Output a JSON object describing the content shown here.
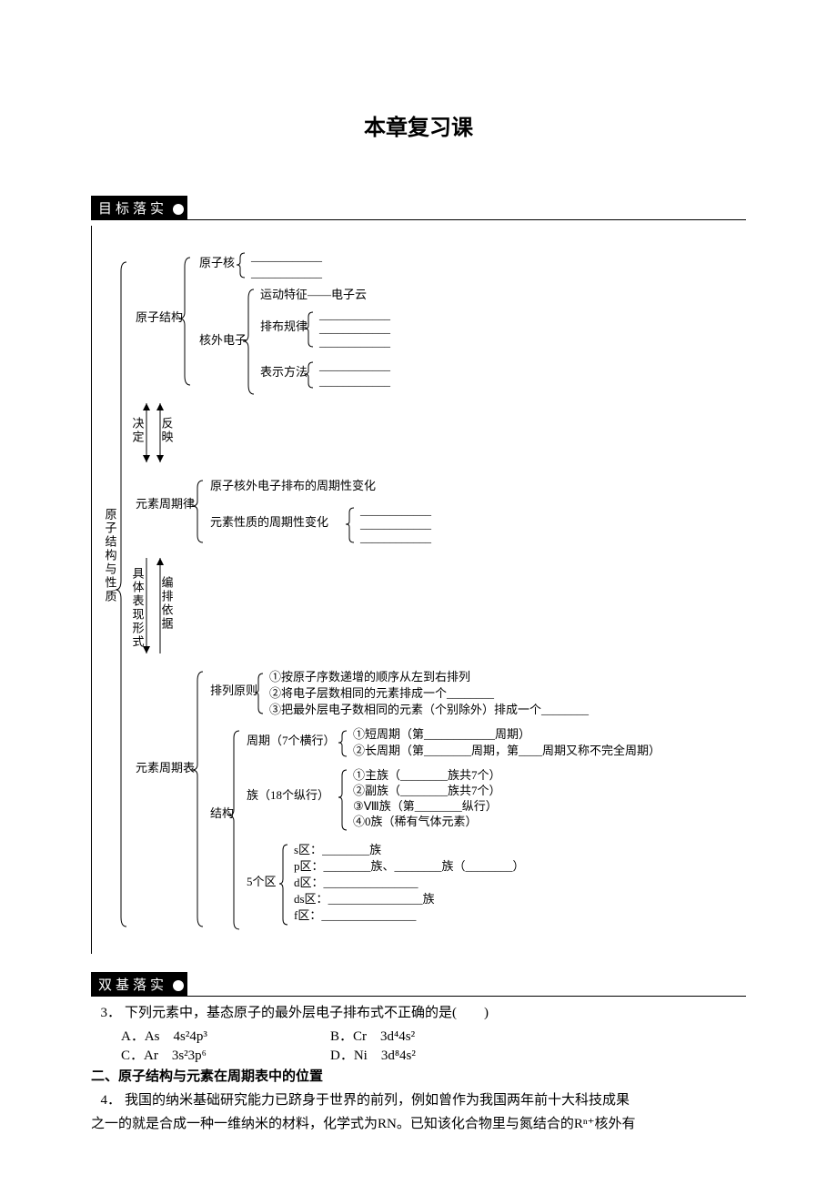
{
  "title": "本章复习课",
  "section1_label": "目标落实",
  "section2_label": "双基落实",
  "outline": {
    "root": "原子结构与性质",
    "arrow_down": "决定",
    "arrow_up": "反映",
    "arrow2_label": "具体表现形式",
    "arrow2_right": "编排依据",
    "n1": {
      "label": "原子结构",
      "a": {
        "label": "原子核",
        "blank1": "____________",
        "blank2": "____________"
      },
      "b": {
        "label": "核外电子",
        "i": "运动特征——电子云",
        "ii": {
          "label": "排布规律",
          "blank1": "____________",
          "blank2": "____________",
          "blank3": "____________"
        },
        "iii": {
          "label": "表示方法",
          "blank1": "____________",
          "blank2": "____________"
        }
      }
    },
    "n2": {
      "label": "元素周期律",
      "a": "原子核外电子排布的周期性变化",
      "b": {
        "label": "元素性质的周期性变化",
        "blank1": "____________",
        "blank2": "____________",
        "blank3": "____________"
      }
    },
    "n3": {
      "label": "元素周期表",
      "a": {
        "label": "排列原则",
        "i": "①按原子序数递增的顺序从左到右排列",
        "ii_pre": "②将电子层数相同的元素排成一个",
        "ii_blank": "________",
        "iii_pre": "③把最外层电子数相同的元素（个别除外）排成一个",
        "iii_blank": "________"
      },
      "b": {
        "label": "结构",
        "period": {
          "label": "周期（7个横行）",
          "i_pre": "①短周期（第",
          "i_blank": "____________",
          "i_post": "周期）",
          "ii_pre": "②长周期（第",
          "ii_blank": "________",
          "ii_mid": "周期，第",
          "ii_blank2": "____",
          "ii_post": "周期又称不完全周期）"
        },
        "group": {
          "label": "族（18个纵行）",
          "i_pre": "①主族（",
          "i_blank": "________",
          "i_post": "族共7个）",
          "ii_pre": "②副族（",
          "ii_blank": "________",
          "ii_post": "族共7个）",
          "iii_pre": "③Ⅷ族（第",
          "iii_blank": "________",
          "iii_post": "纵行）",
          "iv": "④0族（稀有气体元素）"
        },
        "zone": {
          "label": "5个区",
          "s_pre": "s区：",
          "s_blank": "________",
          "s_post": "族",
          "p_pre": "p区：",
          "p_blank1": "________",
          "p_mid": "族、",
          "p_blank2": "________",
          "p_mid2": "族（",
          "p_blank3": "________",
          "p_post": "）",
          "d_pre": "d区：",
          "d_blank": "________________",
          "ds_pre": "ds区：",
          "ds_blank": "________________",
          "ds_post": "族",
          "f_pre": "f区：",
          "f_blank": "________________"
        }
      }
    }
  },
  "q3": {
    "num": "3．",
    "stem": "下列元素中，基态原子的最外层电子排布式不正确的是(　　)",
    "A": "A．As　4s²4p³",
    "B": "B．Cr　3d⁴4s²",
    "C": "C．Ar　3s²3p⁶",
    "D": "D．Ni　3d⁸4s²"
  },
  "sub_heading": "二、原子结构与元素在周期表中的位置",
  "q4": {
    "num": "4．",
    "stem_line1": "我国的纳米基础研究能力已跻身于世界的前列，例如曾作为我国两年前十大科技成果",
    "stem_line2_pre": "之一的就是合成一种一维纳米的材料，化学式为RN。已知该化合物里与氮结合的",
    "r_notation": "Rⁿ⁺",
    "stem_line2_post": "核外有"
  }
}
